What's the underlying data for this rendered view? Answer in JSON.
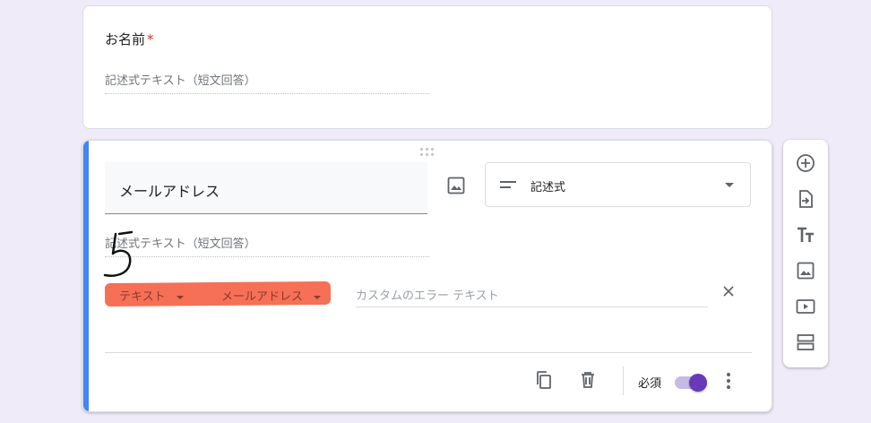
{
  "question1": {
    "title": "お名前",
    "required_mark": "*",
    "answer_placeholder": "記述式テキスト（短文回答）"
  },
  "question2": {
    "title": "メールアドレス",
    "type_select": {
      "selected": "記述式",
      "icon": "short-text-icon"
    },
    "answer_placeholder": "記述式テキスト（短文回答）",
    "validation": {
      "category": "テキスト",
      "condition": "メールアドレス",
      "error_placeholder": "カスタムのエラー テキスト"
    },
    "footer": {
      "required_label": "必須",
      "required_on": true
    }
  },
  "side_toolbar": {
    "tools": [
      "add-question-icon",
      "import-questions-icon",
      "add-title-icon",
      "add-image-icon",
      "add-video-icon",
      "add-section-icon"
    ]
  },
  "colors": {
    "background": "#f0ebf8",
    "accent": "#4285f4",
    "toggle": "#673ab7",
    "highlight": "#f4684d"
  }
}
